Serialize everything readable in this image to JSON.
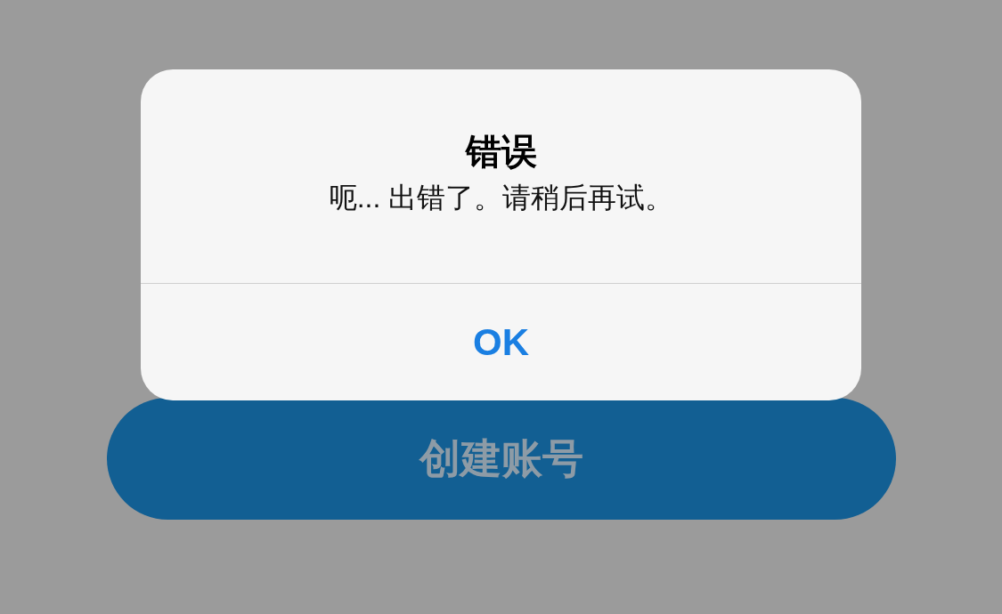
{
  "background": {
    "primary_button": {
      "label": "创建账号",
      "disabled": true
    }
  },
  "alert": {
    "title": "错误",
    "message": "呃... 出错了。请稍后再试。",
    "buttons": [
      {
        "label": "OK"
      }
    ]
  }
}
